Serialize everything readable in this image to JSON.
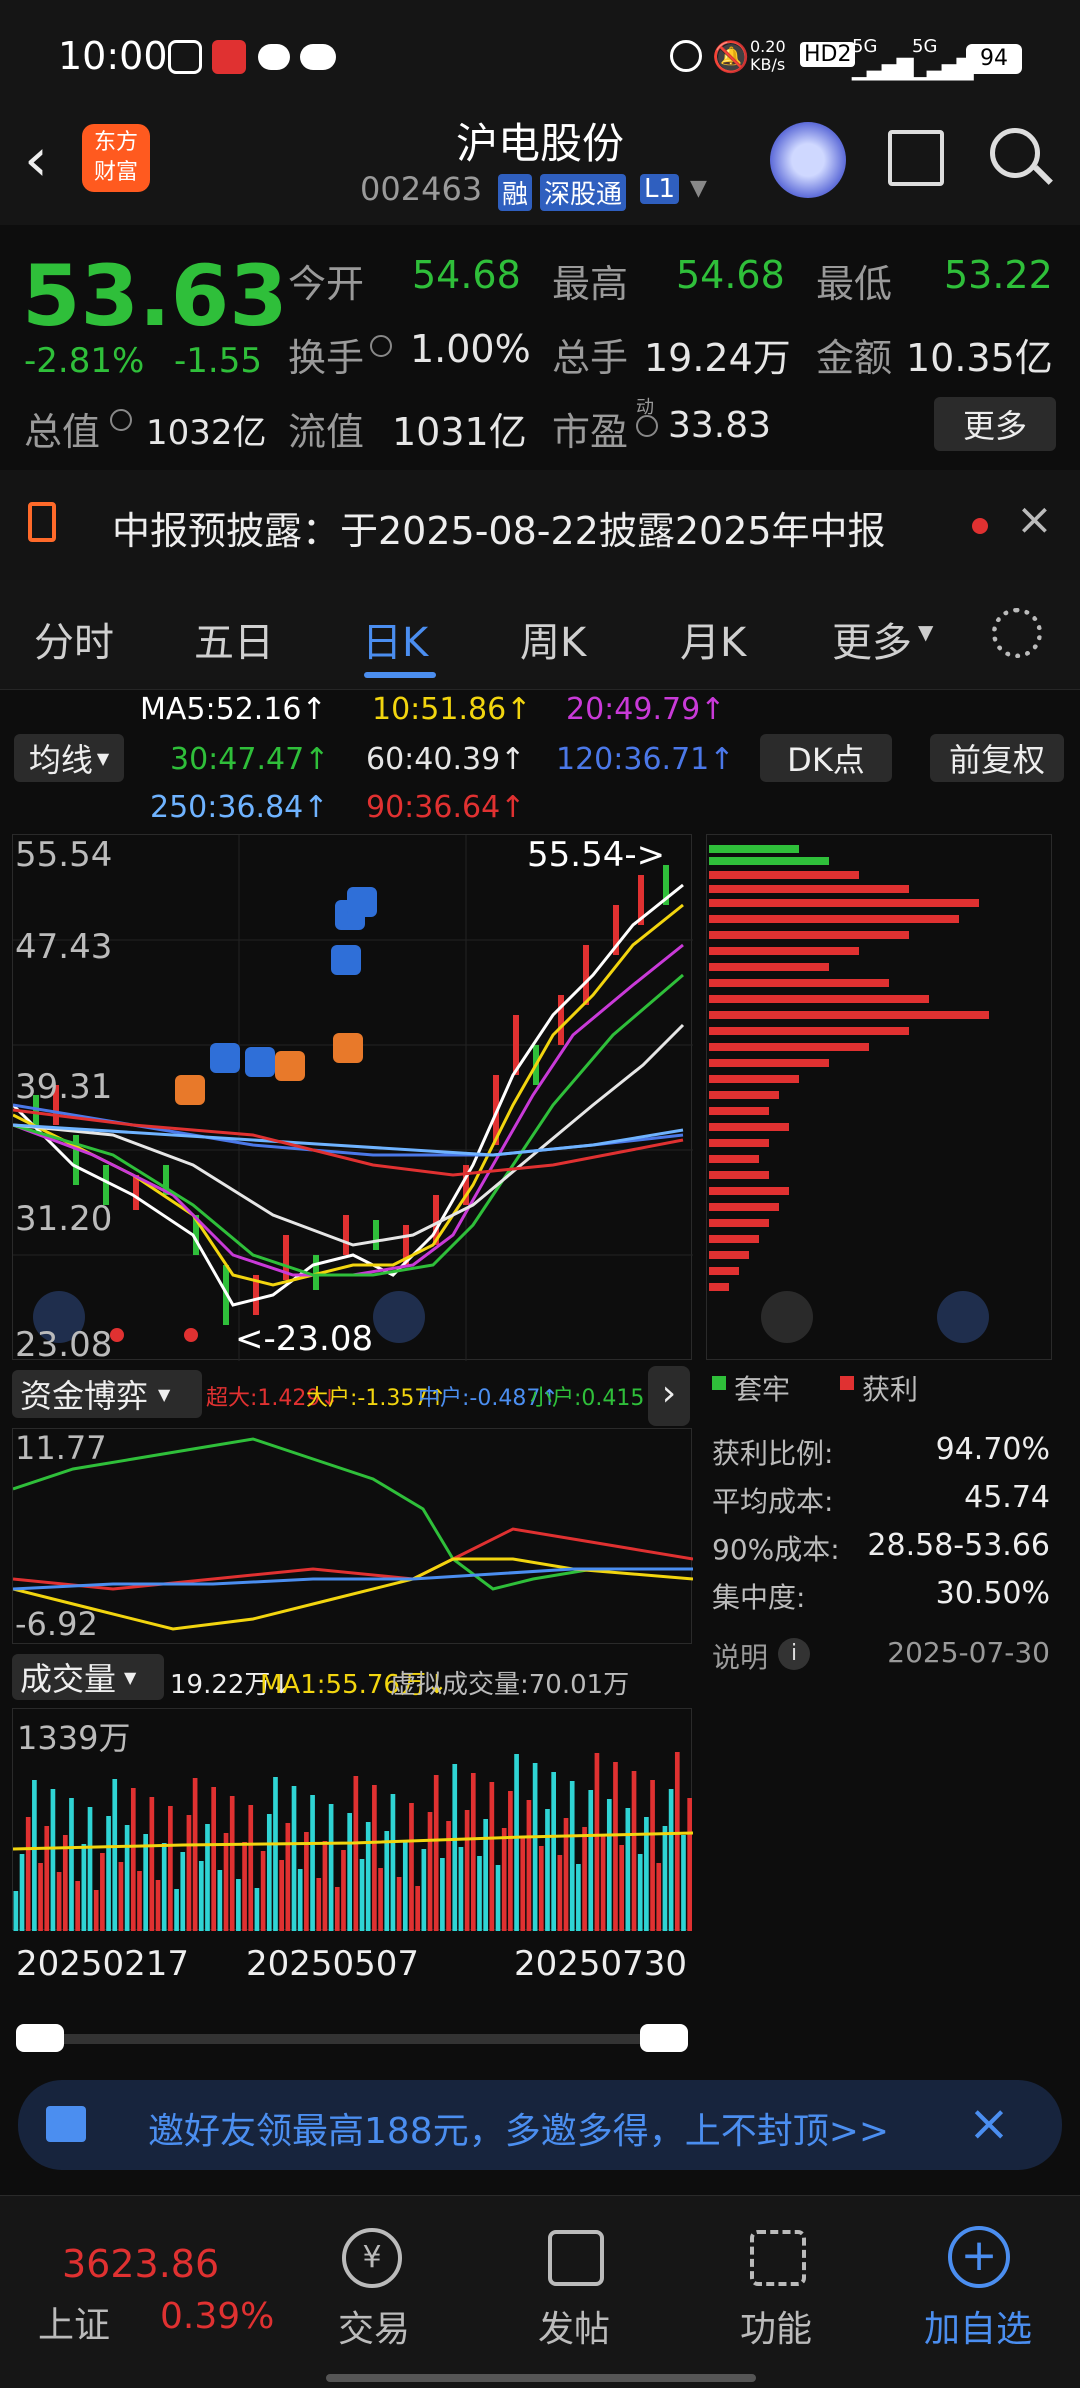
{
  "status": {
    "time": "10:00",
    "net_speed": "0.20\nKB/s",
    "hd": "HD2",
    "sig1": "5G",
    "sig2": "5G",
    "battery": "94"
  },
  "header": {
    "logo_line1": "东方",
    "logo_line2": "财富",
    "title": "沪电股份",
    "code": "002463",
    "tag_rong": "融",
    "tag_sgt": "深股通",
    "tag_l1": "L1"
  },
  "quote": {
    "price": "53.63",
    "change_pct": "-2.81%",
    "change": "-1.55",
    "open_label": "今开",
    "open": "54.68",
    "high_label": "最高",
    "high": "54.68",
    "low_label": "最低",
    "low": "53.22",
    "turnover_label": "换手",
    "turnover": "1.00%",
    "vol_label": "总手",
    "vol": "19.24万",
    "amount_label": "金额",
    "amount": "10.35亿",
    "mktcap_label": "总值",
    "mktcap": "1032亿",
    "float_label": "流值",
    "float": "1031亿",
    "pe_label": "市盈",
    "pe_sup": "动",
    "pe": "33.83",
    "more": "更多"
  },
  "ticker": {
    "text": "中报预披露：于2025-08-22披露2025年中报"
  },
  "tabs": [
    "分时",
    "五日",
    "日K",
    "周K",
    "月K",
    "更多"
  ],
  "ma": {
    "button": "均线",
    "items": [
      {
        "label": "MA5:52.16↑",
        "color": "#ffffff"
      },
      {
        "label": "10:51.86↑",
        "color": "#f2d50f"
      },
      {
        "label": "20:49.79↑",
        "color": "#c93ad8"
      },
      {
        "label": "30:47.47↑",
        "color": "#2fbf3a"
      },
      {
        "label": "60:40.39↑",
        "color": "#e6e6e6"
      },
      {
        "label": "120:36.71↑",
        "color": "#4b78e8"
      },
      {
        "label": "250:36.84↑",
        "color": "#6fb3ff"
      },
      {
        "label": "90:36.64↑",
        "color": "#e03131"
      }
    ],
    "dk": "DK点",
    "fq": "前复权"
  },
  "kchart": {
    "yticks": [
      "55.54",
      "47.43",
      "39.31",
      "31.20",
      "23.08"
    ],
    "max_label": "55.54->",
    "min_label": "<-23.08"
  },
  "capital": {
    "button": "资金博弈",
    "items": [
      {
        "label": "超大:1.429↓",
        "color": "#e03131"
      },
      {
        "label": "大户:-1.357↑",
        "color": "#f2d50f"
      },
      {
        "label": "中户:-0.487↑",
        "color": "#4b8ef0"
      },
      {
        "label": "小户:0.415↑",
        "color": "#2fbf3a"
      }
    ],
    "ymax": "11.77",
    "ymin": "-6.92"
  },
  "volume": {
    "button": "成交量",
    "v1": "19.22万↓",
    "v2": "MA1:55.76万↓",
    "v3": "虚拟成交量:70.01万",
    "ymax": "1339万",
    "dates": [
      "20250217",
      "20250507",
      "20250730"
    ]
  },
  "chips": {
    "legend_trap": "套牢",
    "legend_profit": "获利",
    "rows": [
      {
        "label": "获利比例:",
        "value": "94.70%"
      },
      {
        "label": "平均成本:",
        "value": "45.74"
      },
      {
        "label": "90%成本:",
        "value": "28.58-53.66"
      },
      {
        "label": "集中度:",
        "value": "30.50%"
      }
    ],
    "note": "说明",
    "date": "2025-07-30"
  },
  "banner": {
    "text": "邀好友领最高188元，多邀多得，上不封顶>>"
  },
  "bottom": {
    "index_value": "3623.86",
    "index_name": "上证",
    "index_pct": "0.39%",
    "items": [
      "交易",
      "发帖",
      "功能",
      "加自选"
    ]
  }
}
